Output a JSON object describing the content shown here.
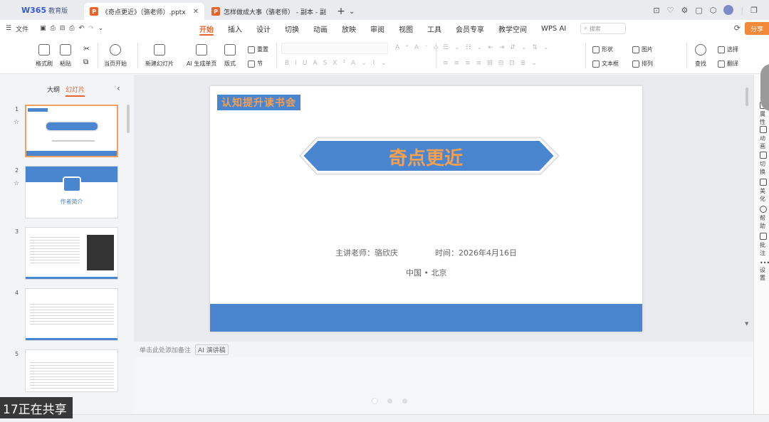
{
  "app": {
    "brand_mark": "W365",
    "brand_text": "教育版"
  },
  "tabs": [
    {
      "label": "《奇点更近》（骆老师）.pptx",
      "icon": "P",
      "active": true
    },
    {
      "label": "怎样做成大事（骆老师） - 副本 - 副",
      "icon": "P",
      "active": false
    }
  ],
  "menubar": {
    "file_label": "文件",
    "tabs": [
      "开始",
      "插入",
      "设计",
      "切换",
      "动画",
      "放映",
      "审阅",
      "视图",
      "工具",
      "会员专享",
      "教学空间",
      "WPS AI"
    ],
    "active_tab": "开始",
    "search_placeholder": "搜索",
    "share_label": "分享"
  },
  "ribbon": {
    "format_painter": "格式刷",
    "paste": "粘贴",
    "from_current": "当页开始",
    "new_slide": "新建幻灯片",
    "ai_single": "AI 生成单页",
    "layout": "版式",
    "reset": "重置",
    "section": "节",
    "shape": "形状",
    "image": "图片",
    "select": "选择",
    "textbox": "文本框",
    "arrange": "排列",
    "find": "查找",
    "translate": "翻译"
  },
  "left_panel": {
    "tab_outline": "大纲",
    "tab_slides": "幻灯片",
    "slides": [
      {
        "num": "1",
        "selected": true
      },
      {
        "num": "2",
        "caption": "作者简介"
      },
      {
        "num": "3"
      },
      {
        "num": "4"
      },
      {
        "num": "5"
      }
    ]
  },
  "slide": {
    "tag": "认知提升读书会",
    "title": "奇点更近",
    "presenter": "主讲老师：骆欣庆",
    "date": "时间：2026年4月16日",
    "location": "中国 • 北京"
  },
  "notes": {
    "placeholder": "单击此处添加备注",
    "ai_button": "AI 演讲稿"
  },
  "right_panel": [
    "属性",
    "动画",
    "切换",
    "美化",
    "帮助",
    "批注",
    "设置"
  ],
  "overlay": {
    "sharing_text": "17正在共享"
  },
  "colors": {
    "accent_orange": "#e8642b",
    "slide_blue": "#4a86d0",
    "title_orange": "#f4a050"
  }
}
